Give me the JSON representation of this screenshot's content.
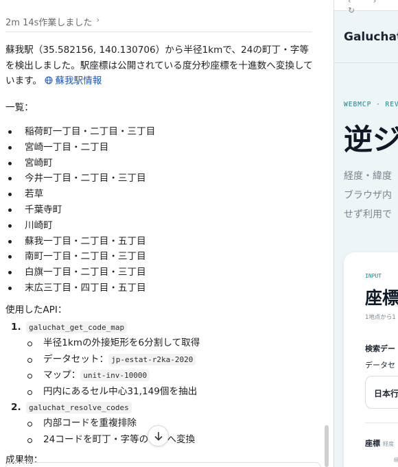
{
  "chat": {
    "thought_summary": "2m 14s作業しました",
    "intro_text": "蘇我駅（35.582156, 140.130706）から半径1kmで、24の町丁・字等を検出しました。駅座標は公開されている度分秒座標を十進数へ変換しています。",
    "intro_link": "蘇我駅情報",
    "list_heading": "一覧：",
    "towns": [
      "稲荷町一丁目・二丁目・三丁目",
      "宮崎一丁目・二丁目",
      "宮崎町",
      "今井一丁目・二丁目・三丁目",
      "若草",
      "千葉寺町",
      "川崎町",
      "蘇我一丁目・二丁目・五丁目",
      "南町一丁目・二丁目・三丁目",
      "白旗一丁目・二丁目・三丁目",
      "末広三丁目・四丁目・五丁目"
    ],
    "api_heading": "使用したAPI：",
    "apis": [
      {
        "number": "1.",
        "name": "galuchat_get_code_map",
        "steps": [
          {
            "text": "半径1kmの外接矩形を6分割して取得",
            "code": ""
          },
          {
            "text": "データセット：",
            "code": "jp-estat-r2ka-2020"
          },
          {
            "text": "マップ：",
            "code": "unit-inv-10000"
          },
          {
            "text": "円内にあるセル中心31,149個を抽出",
            "code": ""
          }
        ]
      },
      {
        "number": "2.",
        "name": "galuchat_resolve_codes",
        "steps": [
          {
            "text": "内部コードを重複排除",
            "code": ""
          },
          {
            "text": "24コードを町丁・字等の名称へ変換",
            "code": ""
          }
        ]
      }
    ],
    "artifacts_heading": "成果物："
  },
  "panel": {
    "brand": "Galuchat",
    "eyebrow": "WEBMCP · REV",
    "hero": "逆ジ",
    "desc_lines": [
      "経度・緯度",
      "ブラウザ内",
      "せず利用で"
    ],
    "card": {
      "tag": "INPUT",
      "title": "座標",
      "subtitle": "1地点から1",
      "dataset_heading": "検索デー",
      "dataset_label": "データセ",
      "dataset_value": "日本行",
      "coord_label": "座標",
      "coord_sub": "経度",
      "tiny": "経"
    }
  },
  "colors": {
    "link": "#1a56c4",
    "accent": "#17838f",
    "panel_bg": "#eef5f6"
  }
}
